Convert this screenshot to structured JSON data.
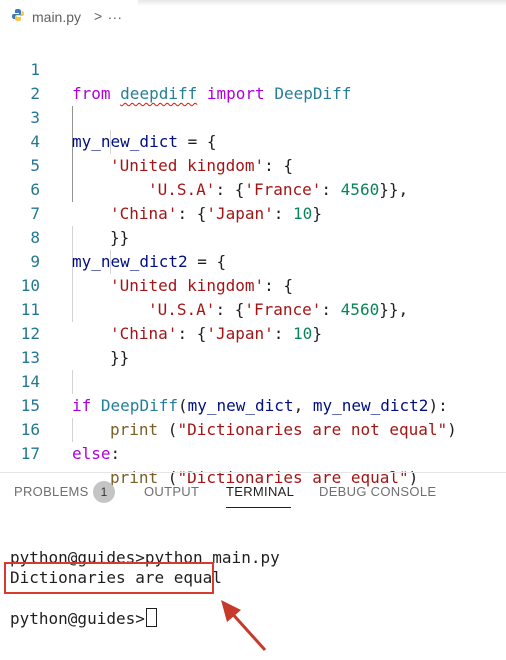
{
  "breadcrumb": {
    "file": "main.py",
    "chevron": ">",
    "more": "..."
  },
  "editor": {
    "lines": [
      {
        "n": "1"
      },
      {
        "n": "2"
      },
      {
        "n": "3"
      },
      {
        "n": "4"
      },
      {
        "n": "5"
      },
      {
        "n": "6"
      },
      {
        "n": "7"
      },
      {
        "n": "8"
      },
      {
        "n": "9"
      },
      {
        "n": "10"
      },
      {
        "n": "11"
      },
      {
        "n": "12"
      },
      {
        "n": "13"
      },
      {
        "n": "14"
      },
      {
        "n": "15"
      },
      {
        "n": "16"
      },
      {
        "n": "17"
      }
    ],
    "tokens": {
      "from": "from",
      "deepdiff": "deepdiff",
      "import": "import",
      "DeepDiff": "DeepDiff",
      "my_new_dict": "my_new_dict",
      "my_new_dict2": "my_new_dict2",
      "assign_open": " = {",
      "united": "'United kingdom'",
      "colon_brace": ": {",
      "usa": "'U.S.A'",
      "france": "'France'",
      "num4560": "4560",
      "close_comma": "}},",
      "china": "'China'",
      "japan": "'Japan'",
      "num10": "10",
      "close": "}",
      "close2": "}}",
      "colon_sp": ": ",
      "colon_sp_brace": ": {",
      "if": "if",
      "paren_open": "(",
      "comma_sp": ", ",
      "paren_close_colon": "):",
      "print": "print",
      "print_open": " (",
      "msg_not_equal": "\"Dictionaries are not equal\"",
      "paren_close": ")",
      "else": "else",
      "colon": ":",
      "msg_equal": "\"Dictionaries are equal\""
    }
  },
  "panel": {
    "tabs": {
      "problems": "PROBLEMS",
      "problems_count": "1",
      "output": "OUTPUT",
      "terminal": "TERMINAL",
      "debug": "DEBUG CONSOLE"
    }
  },
  "terminal": {
    "line1": "python@guides>python main.py",
    "line2": "Dictionaries are equal",
    "prompt": "python@guides>"
  },
  "colors": {
    "keyword": "#0000ff",
    "control": "#af00db",
    "string": "#a31515",
    "number": "#098658",
    "annotation": "#d53c2d"
  }
}
